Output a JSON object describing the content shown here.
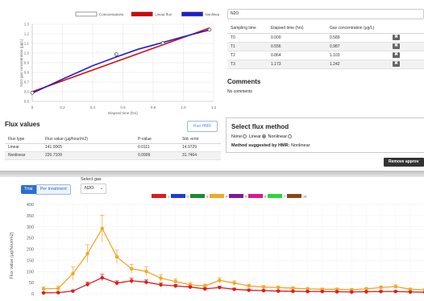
{
  "gas_select_top": {
    "value": "N2O"
  },
  "regression_chart": {
    "legend": [
      {
        "label": "Concentrations",
        "color": "#ffffff"
      },
      {
        "label": "Linear flux",
        "color": "#e30000"
      },
      {
        "label": "Nonlinear flux",
        "color": "#1f1fd6"
      }
    ],
    "xlabel": "Elapsed time (hrs)",
    "ylabel": "N2O gas concentration (μg/L)",
    "x_ticks": [
      "0",
      "0.2",
      "0.4",
      "0.6",
      "0.8",
      "1.0",
      "1.2"
    ],
    "y_ticks": [
      "0.5",
      "0.6",
      "0.7",
      "0.8",
      "0.9",
      "1.0",
      "1.1",
      "1.2",
      "1.3"
    ]
  },
  "chart_data": [
    {
      "type": "scatter",
      "title": "",
      "xlabel": "Elapsed time (hrs)",
      "ylabel": "N2O gas concentration (μg/L)",
      "xlim": [
        0,
        1.2
      ],
      "ylim": [
        0.5,
        1.3
      ],
      "series": [
        {
          "name": "Concentrations",
          "type": "scatter",
          "x": [
            0.0,
            0.556,
            0.864,
            1.173
          ],
          "y": [
            0.589,
            0.987,
            1.103,
            1.242
          ]
        },
        {
          "name": "Linear flux",
          "type": "line",
          "x": [
            0.0,
            1.173
          ],
          "y": [
            0.6,
            1.26
          ]
        },
        {
          "name": "Nonlinear flux",
          "type": "line",
          "x": [
            0.0,
            0.2,
            0.4,
            0.556,
            0.7,
            0.864,
            1.0,
            1.173
          ],
          "y": [
            0.585,
            0.73,
            0.87,
            0.96,
            1.04,
            1.11,
            1.17,
            1.24
          ]
        }
      ],
      "grid": true,
      "legend": "top"
    },
    {
      "type": "line",
      "title": "",
      "ylabel": "Flux value (μg/hour/m2)",
      "ylim": [
        0,
        400
      ],
      "y_ticks": [
        0,
        50,
        100,
        150,
        200,
        250,
        300,
        350,
        400
      ],
      "series": [
        {
          "name": "orange",
          "x": [
            1,
            2,
            3,
            4,
            5,
            6,
            7,
            8,
            9,
            10,
            11,
            12,
            13,
            14,
            15,
            16,
            17,
            18,
            19,
            20,
            21,
            22,
            23,
            24,
            25,
            26,
            27
          ],
          "y": [
            22,
            24,
            90,
            180,
            292,
            165,
            112,
            100,
            70,
            55,
            40,
            35,
            60,
            48,
            35,
            30,
            28,
            25,
            22,
            20,
            20,
            18,
            22,
            28,
            32,
            20,
            18
          ],
          "err": [
            8,
            10,
            30,
            40,
            60,
            30,
            20,
            20,
            15,
            12,
            10,
            8,
            12,
            10,
            8,
            7,
            6,
            6,
            6,
            5,
            5,
            5,
            6,
            7,
            8,
            5,
            5
          ]
        },
        {
          "name": "red",
          "x": [
            1,
            2,
            3,
            4,
            5,
            6,
            7,
            8,
            9,
            10,
            11,
            12,
            13,
            14,
            15,
            16,
            17,
            18,
            19,
            20,
            21,
            22,
            23,
            24,
            25,
            26,
            27
          ],
          "y": [
            4,
            5,
            12,
            42,
            72,
            48,
            58,
            52,
            40,
            35,
            30,
            22,
            28,
            20,
            16,
            14,
            12,
            11,
            10,
            10,
            9,
            8,
            9,
            10,
            10,
            8,
            7
          ],
          "err": [
            3,
            3,
            5,
            10,
            15,
            10,
            12,
            10,
            8,
            7,
            6,
            5,
            6,
            5,
            4,
            4,
            3,
            3,
            3,
            3,
            3,
            3,
            3,
            3,
            3,
            3,
            3
          ]
        }
      ],
      "legend": "top"
    }
  ],
  "concentration_table": {
    "headers": [
      "Sampling time",
      "Elapsed time (hrs)",
      "Gas concentration (μg/L)"
    ],
    "rows": [
      [
        "T0",
        "0.000",
        "0.589"
      ],
      [
        "T1",
        "0.556",
        "0.987"
      ],
      [
        "T2",
        "0.864",
        "1.103"
      ],
      [
        "T3",
        "1.173",
        "1.242"
      ]
    ],
    "delete_icon": "✖"
  },
  "comments": {
    "title": "Comments",
    "text": "No comments"
  },
  "flux_values": {
    "title": "Flux values",
    "run_hmr": "Run HMR",
    "headers": [
      "Flux type",
      "Flux value (μg/hour/m2)",
      "P-value",
      "Std. error"
    ],
    "rows": [
      [
        "Linear",
        "141.0065",
        "0.0111",
        "14.9729"
      ],
      [
        "Nonlinear",
        "220.7109",
        "0.0909",
        "31.7464"
      ]
    ]
  },
  "flux_method": {
    "title": "Select flux method",
    "options": [
      "None",
      "Linear",
      "Nonlinear"
    ],
    "selected": "Linear",
    "suggestion_label": "Method suggested by HMR:",
    "suggestion_value": "Nonlinear"
  },
  "remove_button": "Remove approv",
  "bottom": {
    "tabs": [
      "Trial",
      "Per treatment"
    ],
    "select_gas_label": "Select gas",
    "gas_value": "N2O",
    "ylabel": "Flux value (μg/hour/m2)",
    "legend_colors": [
      "#e01b1b",
      "#1c3fd1",
      "#1a8c2d",
      "#f5a623",
      "#7b1b9e",
      "#e0188a",
      "#29d63d",
      "#8b4513"
    ],
    "legend_labels": [
      "1",
      "2",
      "3",
      "4",
      "5",
      "6",
      "7",
      "16",
      "H"
    ]
  }
}
